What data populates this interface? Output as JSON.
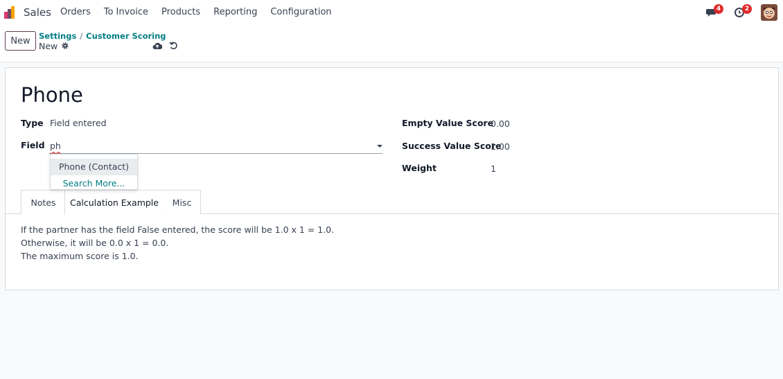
{
  "navbar": {
    "app_name": "Sales",
    "menu": [
      "Orders",
      "To Invoice",
      "Products",
      "Reporting",
      "Configuration"
    ],
    "messages_count": "4",
    "activities_count": "2"
  },
  "control": {
    "new_label": "New",
    "breadcrumb": [
      "Settings",
      "Customer Scoring"
    ],
    "record_name": "New"
  },
  "form": {
    "title": "Phone",
    "type_label": "Type",
    "type_value": "Field entered",
    "field_label": "Field",
    "field_value": "ph",
    "empty_label": "Empty Value Score",
    "empty_value": "0.00",
    "success_label": "Success Value Score",
    "success_value": "1.00",
    "weight_label": "Weight",
    "weight_value": "1"
  },
  "dropdown": {
    "option": "Phone (Contact)",
    "search_more": "Search More..."
  },
  "tabs": [
    "Notes",
    "Calculation Example",
    "Misc"
  ],
  "explanation": [
    "If the partner has the field False entered, the score will be 1.0 x 1 = 1.0.",
    "Otherwise, it will be 0.0 x 1 = 0.0.",
    "The maximum score is 1.0."
  ],
  "colors": {
    "accent": "#017e84",
    "brand": "#714b67",
    "badge": "#e02a2a"
  }
}
